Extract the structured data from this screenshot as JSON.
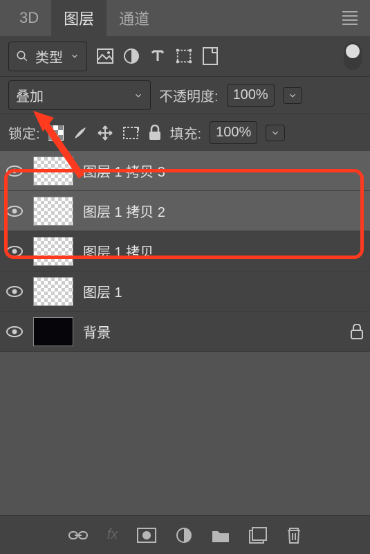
{
  "tabs": {
    "items": [
      {
        "label": "3D",
        "active": false
      },
      {
        "label": "图层",
        "active": true
      },
      {
        "label": "通道",
        "active": false
      }
    ]
  },
  "filter": {
    "label": "类型",
    "icons": [
      "image-icon",
      "adjust-icon",
      "type-icon",
      "shape-icon",
      "smart-icon"
    ]
  },
  "blend": {
    "mode": "叠加",
    "opacity_label": "不透明度:",
    "opacity_value": "100%"
  },
  "lock": {
    "label": "锁定:",
    "fill_label": "填充:",
    "fill_value": "100%"
  },
  "layers": [
    {
      "name": "图层 1 拷贝 3",
      "visible": true,
      "thumb": "checker",
      "selected": true,
      "locked": false
    },
    {
      "name": "图层 1 拷贝 2",
      "visible": true,
      "thumb": "checker",
      "selected": true,
      "locked": false
    },
    {
      "name": "图层 1 拷贝",
      "visible": true,
      "thumb": "checker",
      "selected": false,
      "locked": false
    },
    {
      "name": "图层 1",
      "visible": true,
      "thumb": "checker",
      "selected": false,
      "locked": false
    },
    {
      "name": "背景",
      "visible": true,
      "thumb": "black",
      "selected": false,
      "locked": true
    }
  ],
  "annotation": {
    "highlight_color": "#ff3a1f"
  }
}
